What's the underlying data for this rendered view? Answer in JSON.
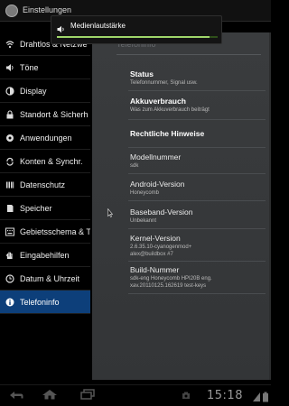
{
  "app": {
    "title": "Einstellungen"
  },
  "volume_toast": {
    "label": "Medienlautstärke",
    "level": 0.95
  },
  "sidebar": {
    "items": [
      {
        "label": "Drahtlos & Netzwe",
        "icon": "wifi-icon"
      },
      {
        "label": "Töne",
        "icon": "speaker-icon"
      },
      {
        "label": "Display",
        "icon": "brightness-icon"
      },
      {
        "label": "Standort & Sicherh",
        "icon": "lock-icon"
      },
      {
        "label": "Anwendungen",
        "icon": "apps-icon"
      },
      {
        "label": "Konten & Synchr.",
        "icon": "sync-icon"
      },
      {
        "label": "Datenschutz",
        "icon": "privacy-icon"
      },
      {
        "label": "Speicher",
        "icon": "storage-icon"
      },
      {
        "label": "Gebietsschema & T",
        "icon": "keyboard-icon"
      },
      {
        "label": "Eingabehilfen",
        "icon": "hand-icon"
      },
      {
        "label": "Datum & Uhrzeit",
        "icon": "clock-icon"
      },
      {
        "label": "Telefoninfo",
        "icon": "info-icon",
        "selected": true
      }
    ]
  },
  "main": {
    "header": "Telefoninfo",
    "prefs": [
      {
        "title": "Status",
        "summary": "Telefonnummer, Signal usw."
      },
      {
        "title": "Akkuverbrauch",
        "summary": "Was zum Akkuverbrauch beiträgt"
      },
      {
        "title": "Rechtliche Hinweise",
        "summary": ""
      },
      {
        "title": "Modellnummer",
        "summary": "sdk"
      },
      {
        "title": "Android-Version",
        "summary": "Honeycomb"
      },
      {
        "title": "Baseband-Version",
        "summary": "Unbekannt"
      },
      {
        "title": "Kernel-Version",
        "summary": "2.6.35.10-cyanogenmod+\nalex@buildbox #7"
      },
      {
        "title": "Build-Nummer",
        "summary": "sdk-eng Honeycomb HPI20B eng.\nxav.20110125.162619 test-keys"
      }
    ]
  },
  "status_bar": {
    "time": "15:18"
  }
}
